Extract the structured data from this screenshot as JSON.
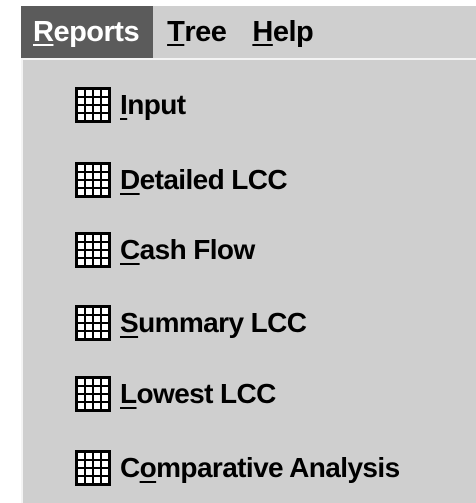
{
  "menubar": {
    "items": [
      {
        "label": "Reports",
        "mnemonic_index": 0,
        "active": true
      },
      {
        "label": "Tree",
        "mnemonic_index": 0,
        "active": false
      },
      {
        "label": "Help",
        "mnemonic_index": 0,
        "active": false
      }
    ]
  },
  "reports_menu": {
    "items": [
      {
        "label": "Input",
        "mnemonic_index": 0,
        "icon": "grid-report-icon"
      },
      {
        "label": "Detailed LCC",
        "mnemonic_index": 0,
        "icon": "grid-report-icon"
      },
      {
        "label": "Cash Flow",
        "mnemonic_index": 0,
        "icon": "grid-report-icon"
      },
      {
        "label": "Summary LCC",
        "mnemonic_index": 0,
        "icon": "grid-report-icon"
      },
      {
        "label": "Lowest LCC",
        "mnemonic_index": 0,
        "icon": "grid-report-icon"
      },
      {
        "label": "Comparative Analysis",
        "mnemonic_index": 1,
        "icon": "grid-report-icon"
      }
    ]
  },
  "colors": {
    "menu_background": "#cfcfcf",
    "active_background": "#5b5b5b",
    "active_text": "#ffffff",
    "text": "#000000"
  }
}
